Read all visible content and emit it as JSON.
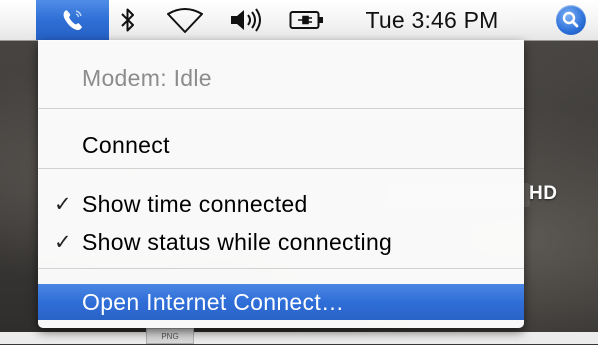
{
  "menubar": {
    "clock": "Tue 3:46 PM",
    "icons": {
      "phone": "internet-connect-phone-icon",
      "bluetooth": "bluetooth-icon",
      "wifi": "airport-wifi-icon",
      "volume": "volume-icon",
      "battery": "battery-plugged-icon",
      "spotlight": "spotlight-search-icon"
    },
    "highlight_color": "#2f6fd6"
  },
  "menu": {
    "status": "Modem: Idle",
    "connect": "Connect",
    "show_time": {
      "label": "Show time connected",
      "checked": true,
      "check_mark": "✓"
    },
    "show_status": {
      "label": "Show status while connecting",
      "checked": true,
      "check_mark": "✓"
    },
    "open_ic": "Open Internet Connect…",
    "selected_color": "#2f6ed8"
  },
  "desktop": {
    "hd_label": "HD",
    "png_label": "PNG"
  }
}
